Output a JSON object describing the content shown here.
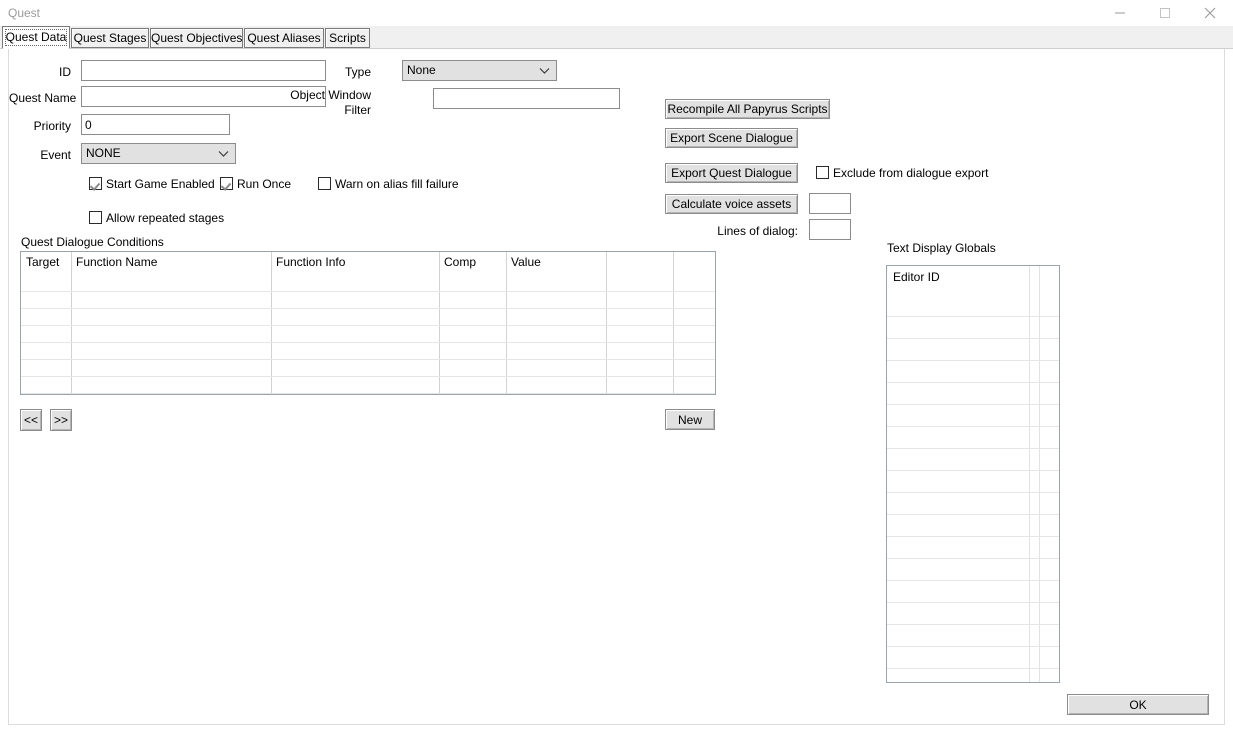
{
  "window": {
    "title": "Quest",
    "controls": {
      "minimize": "minimize",
      "maximize": "maximize",
      "close": "close"
    }
  },
  "tabs": [
    {
      "label": "Quest Data",
      "active": true
    },
    {
      "label": "Quest Stages",
      "active": false
    },
    {
      "label": "Quest Objectives",
      "active": false
    },
    {
      "label": "Quest Aliases",
      "active": false
    },
    {
      "label": "Scripts",
      "active": false
    }
  ],
  "form": {
    "id": {
      "label": "ID",
      "value": "",
      "placeholder": ""
    },
    "quest_name": {
      "label": "Quest Name",
      "value": "",
      "placeholder": ""
    },
    "priority": {
      "label": "Priority",
      "value": "0",
      "placeholder": ""
    },
    "event": {
      "label": "Event",
      "value": "NONE"
    },
    "type": {
      "label": "Type",
      "value": "None"
    },
    "object_window_filter": {
      "label_line1": "Object Window",
      "label_line2": "Filter",
      "value": "",
      "placeholder": ""
    }
  },
  "checkboxes": {
    "start_game_enabled": {
      "label": "Start Game Enabled",
      "checked": true
    },
    "run_once": {
      "label": "Run Once",
      "checked": true
    },
    "warn_on_alias_fill_failure": {
      "label": "Warn on alias fill failure",
      "checked": false
    },
    "allow_repeated_stages": {
      "label": "Allow repeated stages",
      "checked": false
    },
    "exclude_from_dialogue_export": {
      "label": "Exclude from dialogue export",
      "checked": false
    }
  },
  "actions": {
    "recompile_all_papyrus_scripts": "Recompile All Papyrus Scripts",
    "export_scene_dialogue": "Export Scene Dialogue",
    "export_quest_dialogue": "Export Quest Dialogue",
    "calculate_voice_assets": "Calculate voice assets",
    "voice_assets_value": "",
    "lines_of_dialog_label": "Lines of dialog:",
    "lines_of_dialog_value": "",
    "ok": "OK"
  },
  "conditions": {
    "group_label": "Quest Dialogue Conditions",
    "columns": [
      "Target",
      "Function Name",
      "Function Info",
      "Comp",
      "Value",
      "",
      ""
    ],
    "rows": [],
    "nav_first": "<<",
    "nav_next": ">>",
    "new_button": "New"
  },
  "text_display_globals": {
    "label": "Text Display Globals",
    "column": "Editor ID",
    "rows": []
  },
  "colors": {
    "window_bg": "#ffffff",
    "tabstrip_bg": "#f0f0f0",
    "button_face": "#e1e1e1",
    "border": "#8c8c8c",
    "grid_border": "#9aa4ad",
    "gridline": "#e6e6e6",
    "title_text": "#9a9a9a"
  }
}
